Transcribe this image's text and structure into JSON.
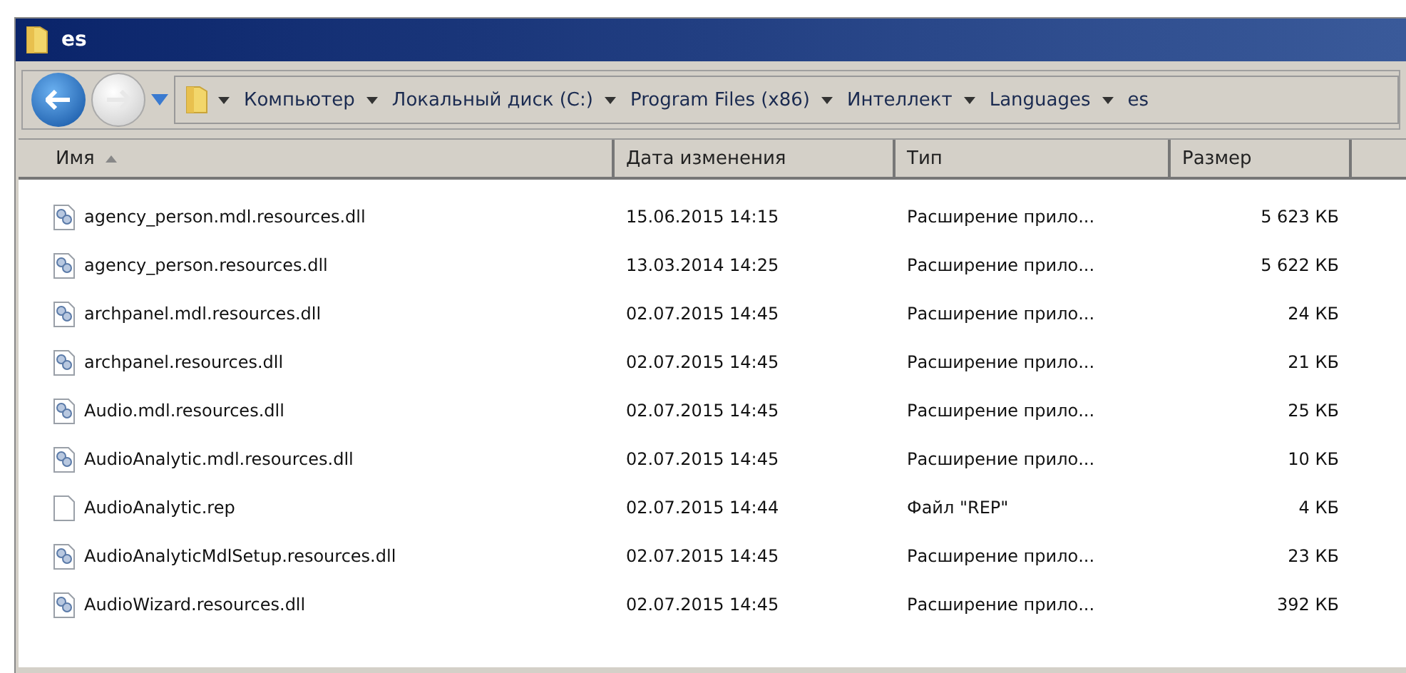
{
  "window": {
    "title": "es"
  },
  "breadcrumb": [
    "Компьютер",
    "Локальный диск (C:)",
    "Program Files (x86)",
    "Интеллект",
    "Languages",
    "es"
  ],
  "table": {
    "columns": [
      {
        "label": "Имя",
        "sorted": true
      },
      {
        "label": "Дата изменения",
        "sorted": false
      },
      {
        "label": "Тип",
        "sorted": false
      },
      {
        "label": "Размер",
        "sorted": false
      }
    ],
    "rows": [
      {
        "kind": "dll",
        "name": "agency_person.mdl.resources.dll",
        "date": "15.06.2015 14:15",
        "type": "Расширение прило...",
        "size": "5 623 КБ"
      },
      {
        "kind": "dll",
        "name": "agency_person.resources.dll",
        "date": "13.03.2014 14:25",
        "type": "Расширение прило...",
        "size": "5 622 КБ"
      },
      {
        "kind": "dll",
        "name": "archpanel.mdl.resources.dll",
        "date": "02.07.2015 14:45",
        "type": "Расширение прило...",
        "size": "24 КБ"
      },
      {
        "kind": "dll",
        "name": "archpanel.resources.dll",
        "date": "02.07.2015 14:45",
        "type": "Расширение прило...",
        "size": "21 КБ"
      },
      {
        "kind": "dll",
        "name": "Audio.mdl.resources.dll",
        "date": "02.07.2015 14:45",
        "type": "Расширение прило...",
        "size": "25 КБ"
      },
      {
        "kind": "dll",
        "name": "AudioAnalytic.mdl.resources.dll",
        "date": "02.07.2015 14:45",
        "type": "Расширение прило...",
        "size": "10 КБ"
      },
      {
        "kind": "file",
        "name": "AudioAnalytic.rep",
        "date": "02.07.2015 14:44",
        "type": "Файл \"REP\"",
        "size": "4 КБ"
      },
      {
        "kind": "dll",
        "name": "AudioAnalyticMdlSetup.resources.dll",
        "date": "02.07.2015 14:45",
        "type": "Расширение прило...",
        "size": "23 КБ"
      },
      {
        "kind": "dll",
        "name": "AudioWizard.resources.dll",
        "date": "02.07.2015 14:45",
        "type": "Расширение прило...",
        "size": "392 КБ"
      }
    ]
  }
}
